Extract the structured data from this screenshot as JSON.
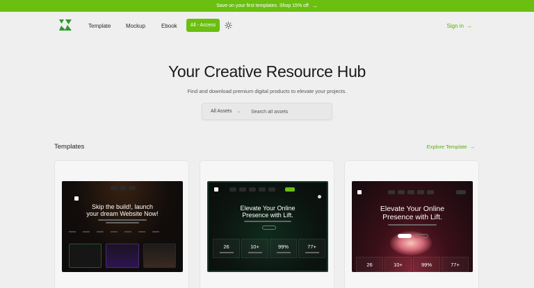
{
  "promo": {
    "text": "Save on your first templates. Shop 15% off",
    "arrow": "→"
  },
  "nav": {
    "links": [
      "Template",
      "Mockup",
      "Ebook"
    ],
    "access_label": "All - Access",
    "signin_label": "Sign in",
    "signin_arrow": "→"
  },
  "hero": {
    "title": "Your Creative Resource Hub",
    "subtitle": "Find and download premium digital products to elevate your projects."
  },
  "search": {
    "filter_label": "All Assets",
    "chevron": "⌄",
    "placeholder": "Search all assets"
  },
  "section": {
    "title": "Templates",
    "explore_label": "Explore Template",
    "explore_arrow": "→"
  },
  "cards": [
    {
      "headline_1": "Skip the build!, launch",
      "headline_2": "your dream Website Now!"
    },
    {
      "headline_1": "Elevate Your Online",
      "headline_2": "Presence with Lift.",
      "stats": [
        "26",
        "10+",
        "99%",
        "77+"
      ]
    },
    {
      "headline_1": "Elevate Your Online",
      "headline_2": "Presence with Lift.",
      "stats": [
        "26",
        "10+",
        "99%",
        "77+"
      ]
    }
  ],
  "colors": {
    "accent": "#6bbf10",
    "link": "#5cae0a",
    "background": "#efefef"
  }
}
